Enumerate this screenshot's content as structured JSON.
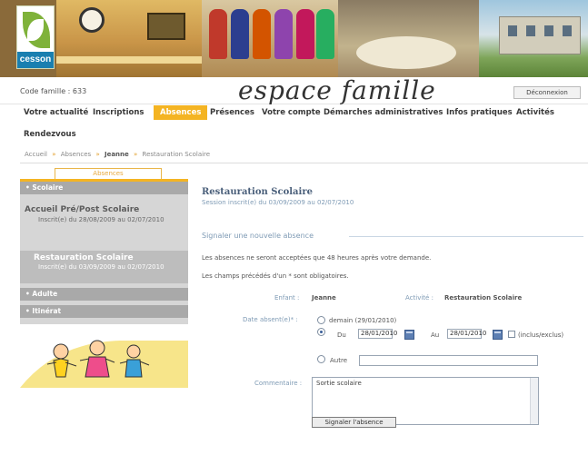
{
  "banner": {
    "town_name": "cesson",
    "colors": {
      "brand_green": "#7fb23a",
      "brand_blue": "#1a7fb0"
    }
  },
  "header": {
    "family_code": "Code famille : 633",
    "site_title": "espace famille",
    "logout_label": "Déconnexion"
  },
  "nav": {
    "items": [
      {
        "label": "Votre actualité"
      },
      {
        "label": "Inscriptions"
      },
      {
        "label": "Absences",
        "active": true
      },
      {
        "label": "Présences"
      },
      {
        "label": "Votre compte"
      },
      {
        "label": "Démarches administratives"
      },
      {
        "label": "Infos pratiques"
      },
      {
        "label": "Activités"
      },
      {
        "label": "Rendezvous"
      }
    ],
    "active_color": "#f4b423"
  },
  "breadcrumb": {
    "items": [
      "Accueil",
      "Absences",
      "Jeanne",
      "Restauration Scolaire"
    ]
  },
  "sidebar": {
    "tab_label": "Absences",
    "sections": [
      {
        "head": "• Scolaire",
        "entries": [
          {
            "title": "Accueil Pré/Post Scolaire",
            "subtitle": "Inscrit(e) du 28/08/2009 au 02/07/2010"
          },
          {
            "title": "Restauration Scolaire",
            "subtitle": "Inscrit(e) du 03/09/2009 au 02/07/2010",
            "active": true
          }
        ]
      },
      {
        "head": "• Adulte"
      },
      {
        "head": "• Itinérat"
      }
    ]
  },
  "main": {
    "title": "Restauration Scolaire",
    "session_info": "Session inscrit(e) du 03/09/2009 au 02/07/2010",
    "form_legend": "Signaler une nouvelle absence",
    "notes": [
      "Les absences ne seront acceptées que 48 heures après votre demande.",
      "Les champs précédés d'un * sont obligatoires."
    ],
    "child_label": "Enfant :",
    "child_value": "Jeanne",
    "activity_label": "Activité :",
    "activity_value": "Restauration Scolaire",
    "absence_label": "Date absent(e)* :",
    "option_today": "demain (29/01/2010)",
    "option_range_from": "Du",
    "option_range_to": "Au",
    "date_from": "28/01/2010",
    "date_to": "28/01/2010",
    "checkbox_label": "(inclus/exclus)",
    "option_other": "Autre",
    "comment_label": "Commentaire :",
    "comment_value": "Sortie scolaire",
    "submit_label": "Signaler l'absence"
  }
}
